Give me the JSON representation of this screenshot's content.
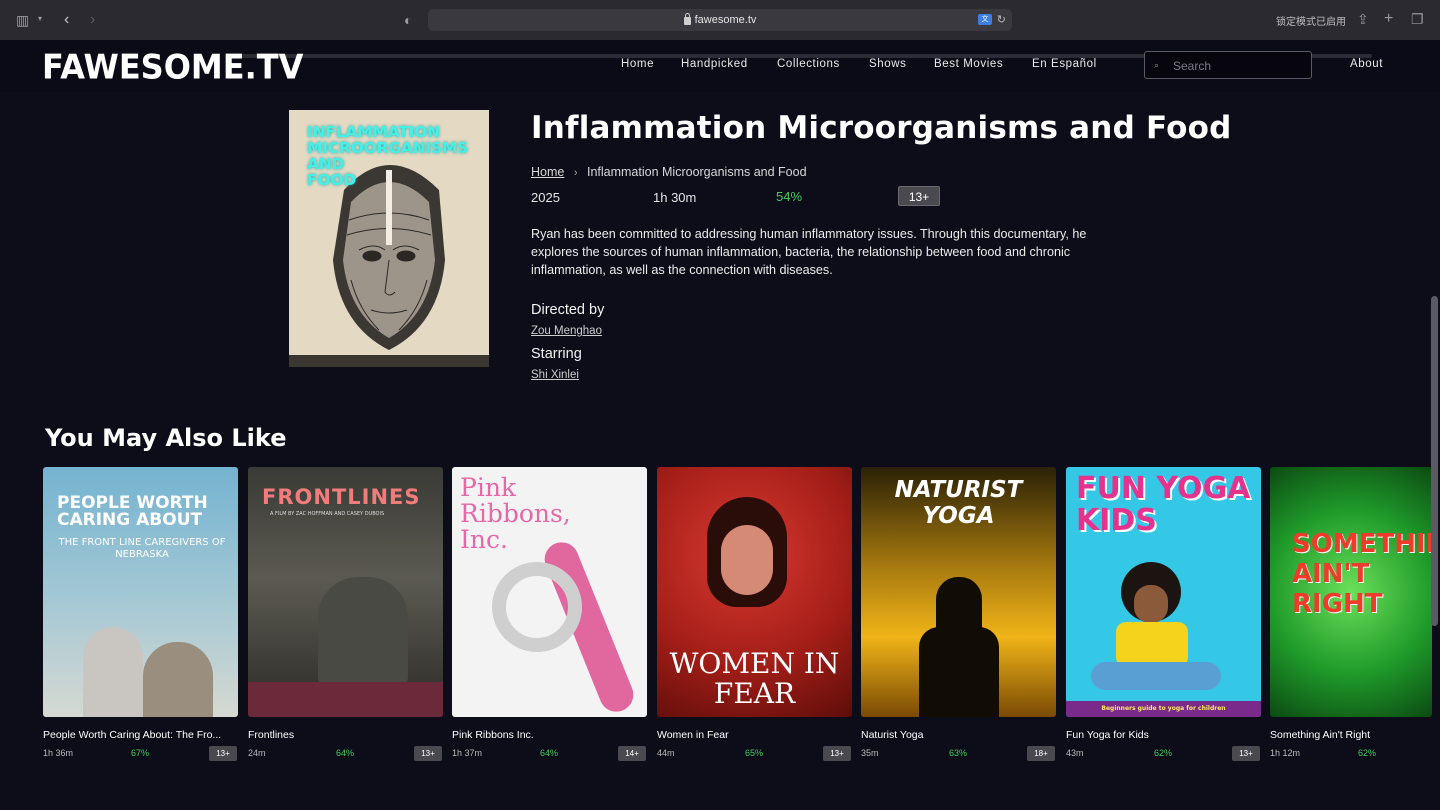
{
  "browser": {
    "url": "fawesome.tv",
    "lockdown_text": "锁定模式已启用"
  },
  "site": {
    "logo": "FAWESOME.TV",
    "nav": [
      "Home",
      "Handpicked",
      "Collections",
      "Shows",
      "Best Movies",
      "En Español"
    ],
    "search_placeholder": "Search",
    "about": "About"
  },
  "movie": {
    "title": "Inflammation Microorganisms and Food",
    "poster_title": "INFLAMMATION\nMICROORGANISMS\nAND\nFOOD",
    "breadcrumb": {
      "home": "Home",
      "current": "Inflammation Microorganisms and Food"
    },
    "year": "2025",
    "duration": "1h 30m",
    "score": "54%",
    "rating": "13+",
    "description": "Ryan has been committed to addressing human inflammatory issues. Through this documentary, he explores the sources of human inflammation, bacteria, the relationship between food and chronic inflammation, as well as the connection with diseases.",
    "directed_label": "Directed by",
    "director": "Zou Menghao",
    "starring_label": "Starring",
    "star": "Shi Xinlei"
  },
  "recommendations": {
    "title": "You May Also Like",
    "items": [
      {
        "name": "People Worth Caring About: The Fro...",
        "duration": "1h 36m",
        "score": "67%",
        "rating": "13+",
        "poster_text": "PEOPLE WORTH CARING ABOUT",
        "poster_sub": "THE FRONT LINE CAREGIVERS OF NEBRASKA"
      },
      {
        "name": "Frontlines",
        "duration": "24m",
        "score": "64%",
        "rating": "13+",
        "poster_text": "FRONTLINES",
        "poster_sub": "A FILM BY ZAC HOFFMAN AND CASEY DUBOIS"
      },
      {
        "name": "Pink Ribbons Inc.",
        "duration": "1h 37m",
        "score": "64%",
        "rating": "14+",
        "poster_text": "Pink Ribbons, Inc."
      },
      {
        "name": "Women in Fear",
        "duration": "44m",
        "score": "65%",
        "rating": "13+",
        "poster_text": "WOMEN IN FEAR"
      },
      {
        "name": "Naturist Yoga",
        "duration": "35m",
        "score": "63%",
        "rating": "18+",
        "poster_text": "NATURIST YOGA"
      },
      {
        "name": "Fun Yoga for Kids",
        "duration": "43m",
        "score": "62%",
        "rating": "13+",
        "poster_text": "FUN YOGA KIDS",
        "poster_sub": "Beginners guide to yoga for children"
      },
      {
        "name": "Something Ain't Right",
        "duration": "1h 12m",
        "score": "62%",
        "rating": "13+",
        "poster_text": "SOMETHING AIN'T RIGHT"
      }
    ]
  },
  "colors": {
    "accent_green": "#3fcf5c",
    "background": "#0d0c19",
    "poster_cyan": "#43f0e8"
  }
}
